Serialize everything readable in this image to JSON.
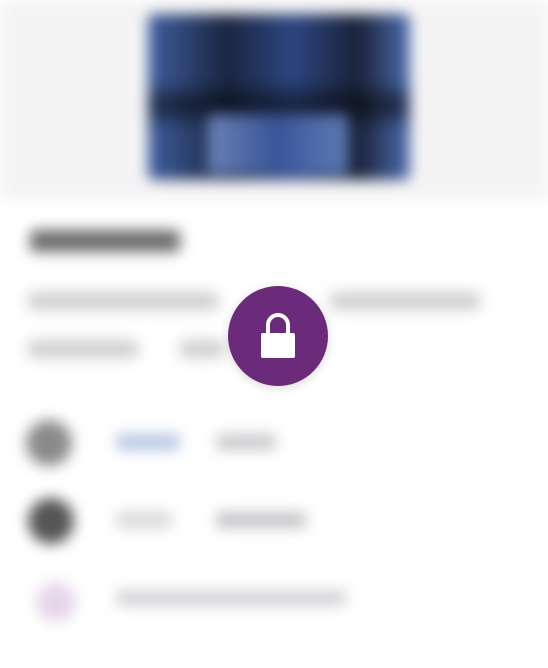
{
  "overlay": {
    "lock_icon": "lock-icon",
    "accent_color": "#6b2a7a",
    "content_state": "blurred"
  },
  "blurred_content": {
    "hero_image": "image-placeholder",
    "rows": [
      {
        "icon": "round-icon"
      },
      {
        "icon": "round-icon"
      },
      {
        "icon": "round-icon"
      }
    ]
  }
}
